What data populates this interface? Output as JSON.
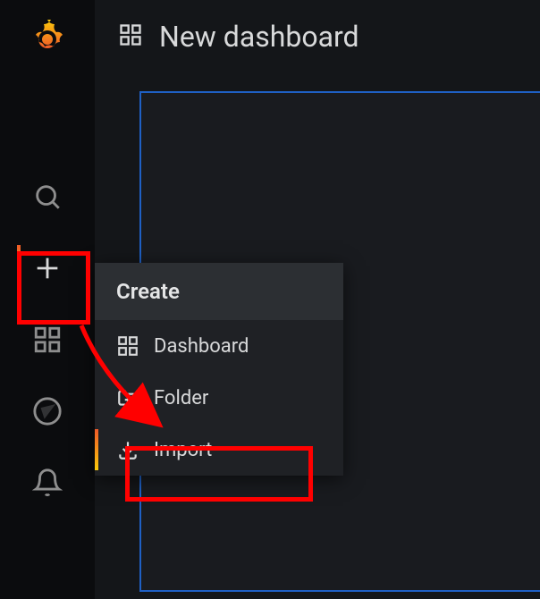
{
  "header": {
    "title": "New dashboard"
  },
  "flyout": {
    "title": "Create",
    "items": [
      {
        "label": "Dashboard",
        "icon": "dashboard"
      },
      {
        "label": "Folder",
        "icon": "folder-plus"
      },
      {
        "label": "Import",
        "icon": "import",
        "active": true
      }
    ]
  },
  "sidebar": {
    "icons": [
      {
        "name": "search"
      },
      {
        "name": "plus",
        "active": true
      },
      {
        "name": "dashboard"
      },
      {
        "name": "explore"
      },
      {
        "name": "alerting"
      }
    ]
  }
}
